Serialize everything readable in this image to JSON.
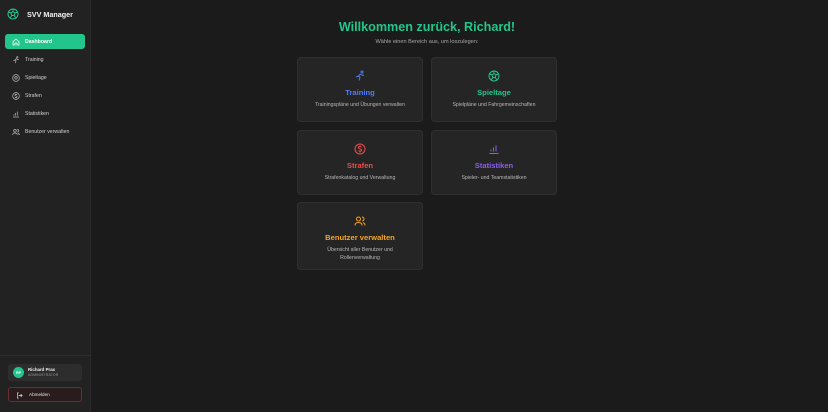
{
  "app": {
    "title": "SVV Manager"
  },
  "sidebar": {
    "items": [
      {
        "label": "Dashboard",
        "icon": "home-icon",
        "active": true
      },
      {
        "label": "Training",
        "icon": "training-icon"
      },
      {
        "label": "Spieltage",
        "icon": "soccer-ball-icon"
      },
      {
        "label": "Strafen",
        "icon": "money-icon"
      },
      {
        "label": "Statistiken",
        "icon": "bar-chart-icon"
      },
      {
        "label": "Benutzer verwalten",
        "icon": "users-icon"
      }
    ],
    "user": {
      "initials": "RP",
      "name": "Richard Prax",
      "role": "ADMINISTRATOR"
    },
    "logout_label": "Abmelden"
  },
  "main": {
    "welcome": "Willkommen zurück, Richard!",
    "subtitle": "Wähle einen Bereich aus, um loszulegen:",
    "cards": [
      {
        "title": "Training",
        "desc": "Trainingspläne und Übungen verwalten",
        "icon": "training-icon",
        "color": "#4f7cf7"
      },
      {
        "title": "Spieltage",
        "desc": "Spielpläne und Fahrgemeinschaften",
        "icon": "soccer-ball-icon",
        "color": "#22c58b"
      },
      {
        "title": "Strafen",
        "desc": "Strafenkatalog und Verwaltung",
        "icon": "money-icon",
        "color": "#ef4b4b"
      },
      {
        "title": "Statistiken",
        "desc": "Spieler- und Teamstatistiken",
        "icon": "bar-chart-icon",
        "color": "#8b5cf6"
      },
      {
        "title": "Benutzer verwalten",
        "desc": "Übersicht aller Benutzer und Rollenverwaltung",
        "icon": "users-icon",
        "color": "#f5a524"
      }
    ]
  },
  "colors": {
    "accent": "#22c58b",
    "background": "#1b1b1b",
    "sidebar": "#222222",
    "card": "#252525"
  }
}
